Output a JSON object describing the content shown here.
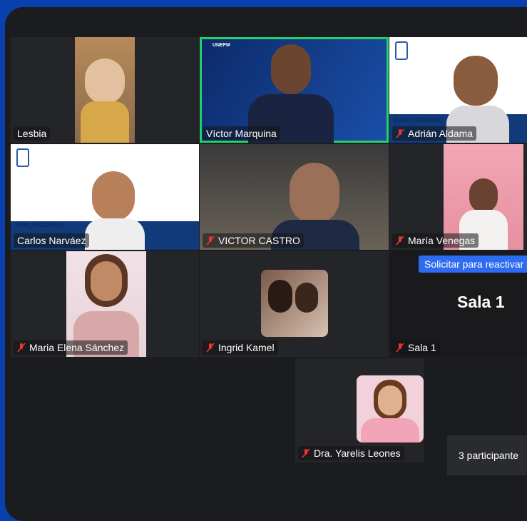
{
  "participants": {
    "p1": "Lesbia",
    "p2": "Víctor Marquina",
    "p3": "Adrián Aldama",
    "p4": "Carlos Narváez",
    "p5": "VICTOR CASTRO",
    "p6": "María Venegas",
    "p7": "Maria Elena Sánchez",
    "p8": "Ingrid Kamel",
    "p9": "Sala 1",
    "p10": "Dra. Yarelis Leones"
  },
  "slide": {
    "evaluator_label": "EVALUADOR(A)",
    "brand": "UNEFM"
  },
  "reactivate_button": "Solicitar para reactivar a",
  "room_title": "Sala 1",
  "participant_count": "3 participante"
}
